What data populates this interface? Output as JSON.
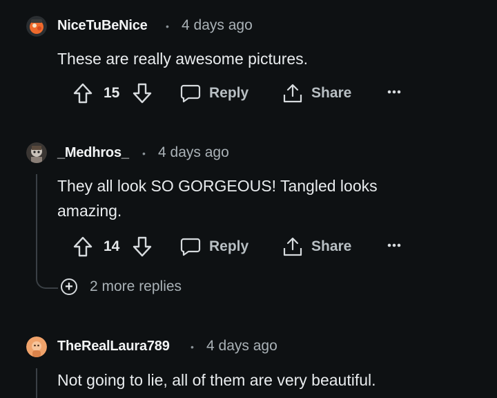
{
  "comments": [
    {
      "username": "NiceTuBeNice",
      "separator": "•",
      "time": "4 days ago",
      "text_lines": [
        "These are really awesome pictures."
      ],
      "votes": "15",
      "reply_label": "Reply",
      "share_label": "Share",
      "avatar_color": "#ef6a2c"
    },
    {
      "username": "_Medhros_",
      "separator": "•",
      "time": "4 days ago",
      "text_lines": [
        "They all look SO GORGEOUS! Tangled looks",
        "amazing."
      ],
      "votes": "14",
      "reply_label": "Reply",
      "share_label": "Share",
      "more_replies": "2 more replies",
      "avatar_color": "#6d6966"
    },
    {
      "username": "TheRealLaura789",
      "separator": "•",
      "time": "4 days ago",
      "text_lines": [
        "Not going to lie, all of them are very beautiful."
      ],
      "avatar_color": "#f0a36b"
    }
  ],
  "icons": {
    "upvote": "arrow-up-icon",
    "downvote": "arrow-down-icon",
    "reply": "comment-bubble-icon",
    "share": "share-icon",
    "more": "more-options-icon",
    "expand": "plus-circle-icon"
  },
  "colors": {
    "background": "#0e1113",
    "thread_line": "#3a4045",
    "muted_text": "#aab2b7"
  }
}
